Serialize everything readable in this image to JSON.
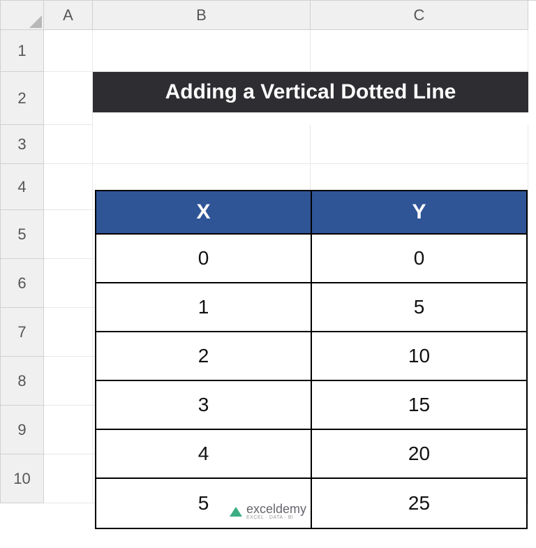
{
  "columns": [
    "A",
    "B",
    "C"
  ],
  "rows": [
    "1",
    "2",
    "3",
    "4",
    "5",
    "6",
    "7",
    "8",
    "9",
    "10"
  ],
  "title": "Adding a Vertical Dotted Line",
  "table": {
    "headers": [
      "X",
      "Y"
    ],
    "data": [
      [
        "0",
        "0"
      ],
      [
        "1",
        "5"
      ],
      [
        "2",
        "10"
      ],
      [
        "3",
        "15"
      ],
      [
        "4",
        "20"
      ],
      [
        "5",
        "25"
      ]
    ]
  },
  "watermark": {
    "brand": "exceldemy",
    "tagline": "EXCEL · DATA · BI"
  }
}
